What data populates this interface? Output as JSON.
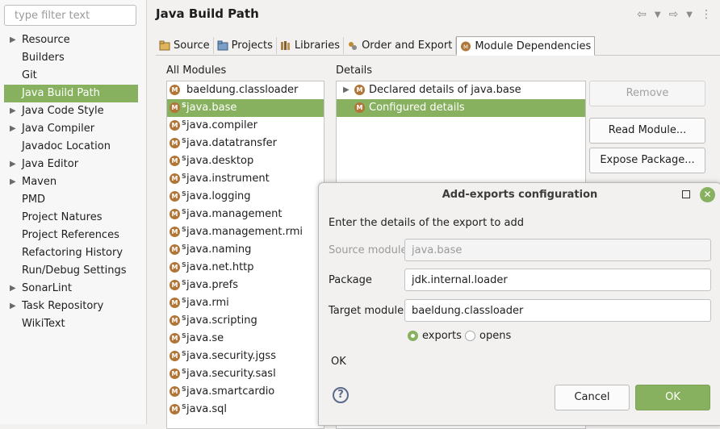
{
  "sidebar": {
    "filter_placeholder": "type filter text",
    "items": [
      {
        "label": "Resource",
        "expandable": true
      },
      {
        "label": "Builders",
        "expandable": false
      },
      {
        "label": "Git",
        "expandable": false
      },
      {
        "label": "Java Build Path",
        "expandable": false,
        "selected": true
      },
      {
        "label": "Java Code Style",
        "expandable": true
      },
      {
        "label": "Java Compiler",
        "expandable": true
      },
      {
        "label": "Javadoc Location",
        "expandable": false
      },
      {
        "label": "Java Editor",
        "expandable": true
      },
      {
        "label": "Maven",
        "expandable": true
      },
      {
        "label": "PMD",
        "expandable": false
      },
      {
        "label": "Project Natures",
        "expandable": false
      },
      {
        "label": "Project References",
        "expandable": false
      },
      {
        "label": "Refactoring History",
        "expandable": false
      },
      {
        "label": "Run/Debug Settings",
        "expandable": false
      },
      {
        "label": "SonarLint",
        "expandable": true
      },
      {
        "label": "Task Repository",
        "expandable": true
      },
      {
        "label": "WikiText",
        "expandable": false
      }
    ]
  },
  "header": {
    "title": "Java Build Path",
    "back_icon": "back-arrow-icon",
    "forward_icon": "forward-arrow-icon",
    "menu_icon": "view-menu-icon"
  },
  "tabs": [
    {
      "label": "Source",
      "icon": "source-folder-icon"
    },
    {
      "label": "Projects",
      "icon": "projects-icon"
    },
    {
      "label": "Libraries",
      "icon": "libraries-icon"
    },
    {
      "label": "Order and Export",
      "icon": "order-export-icon"
    },
    {
      "label": "Module Dependencies",
      "icon": "module-icon",
      "active": true
    }
  ],
  "modules": {
    "label": "All Modules",
    "items": [
      {
        "name": "baeldung.classloader",
        "system": false
      },
      {
        "name": "java.base",
        "system": true,
        "selected": true
      },
      {
        "name": "java.compiler",
        "system": true
      },
      {
        "name": "java.datatransfer",
        "system": true
      },
      {
        "name": "java.desktop",
        "system": true
      },
      {
        "name": "java.instrument",
        "system": true
      },
      {
        "name": "java.logging",
        "system": true
      },
      {
        "name": "java.management",
        "system": true
      },
      {
        "name": "java.management.rmi",
        "system": true
      },
      {
        "name": "java.naming",
        "system": true
      },
      {
        "name": "java.net.http",
        "system": true
      },
      {
        "name": "java.prefs",
        "system": true
      },
      {
        "name": "java.rmi",
        "system": true
      },
      {
        "name": "java.scripting",
        "system": true
      },
      {
        "name": "java.se",
        "system": true
      },
      {
        "name": "java.security.jgss",
        "system": true
      },
      {
        "name": "java.security.sasl",
        "system": true
      },
      {
        "name": "java.smartcardio",
        "system": true
      },
      {
        "name": "java.sql",
        "system": true
      }
    ]
  },
  "details": {
    "label": "Details",
    "items": [
      {
        "label": "Declared details of java.base",
        "expandable": true
      },
      {
        "label": "Configured details",
        "expandable": false,
        "selected": true
      }
    ]
  },
  "buttons": {
    "remove": "Remove",
    "read_module": "Read Module...",
    "expose_package": "Expose Package..."
  },
  "dialog": {
    "title": "Add-exports configuration",
    "message": "Enter the details of the export to add",
    "source_module_label": "Source module",
    "source_module_value": "java.base",
    "package_label": "Package",
    "package_value": "jdk.internal.loader",
    "target_module_label": "Target module",
    "target_module_value": "baeldung.classloader",
    "radio_exports": "exports",
    "radio_opens": "opens",
    "selected_radio": "exports",
    "status": "OK",
    "cancel": "Cancel",
    "ok": "OK"
  },
  "colors": {
    "accent": "#87b15e",
    "module_icon": "#b07638"
  }
}
